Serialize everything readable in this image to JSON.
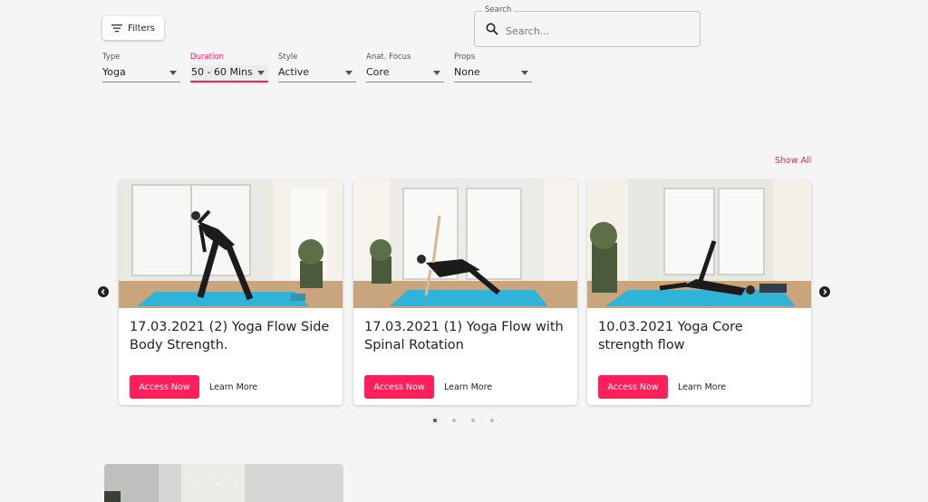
{
  "toolbar": {
    "filters_label": "Filters"
  },
  "search": {
    "label": "Search",
    "placeholder": "Search..."
  },
  "filters": [
    {
      "label": "Type",
      "value": "Yoga"
    },
    {
      "label": "Duration",
      "value": "50 - 60 Mins"
    },
    {
      "label": "Style",
      "value": "Active"
    },
    {
      "label": "Anat. Focus",
      "value": "Core"
    },
    {
      "label": "Props",
      "value": "None"
    }
  ],
  "carousel": {
    "show_all_label": "Show All",
    "cards": [
      {
        "title": "17.03.2021 (2) Yoga Flow Side Body Strength.",
        "access_label": "Access Now",
        "learn_label": "Learn More"
      },
      {
        "title": "17.03.2021 (1) Yoga Flow with Spinal Rotation",
        "access_label": "Access Now",
        "learn_label": "Learn More"
      },
      {
        "title": "10.03.2021 Yoga Core strength flow",
        "access_label": "Access Now",
        "learn_label": "Learn More"
      }
    ],
    "page_count": 4,
    "active_page": 1
  },
  "colors": {
    "accent": "#ff1f5a",
    "background": "#f5f5f5",
    "mat": "#2fb3d8"
  }
}
